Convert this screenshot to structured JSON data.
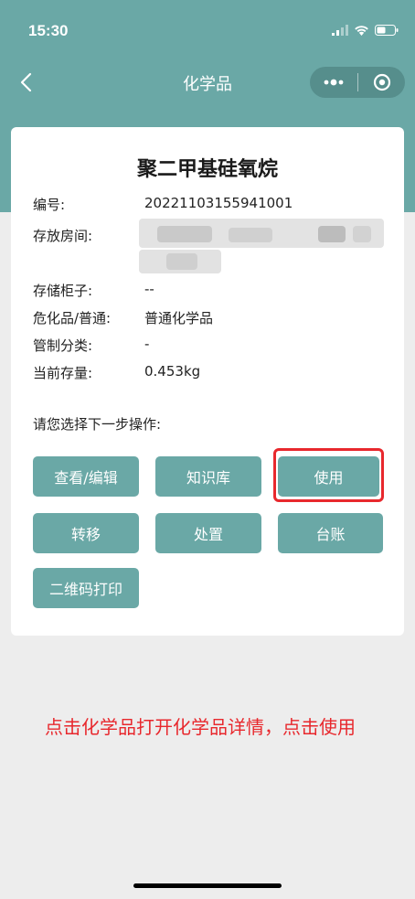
{
  "status_bar": {
    "time": "15:30"
  },
  "nav": {
    "title": "化学品"
  },
  "card": {
    "title": "聚二甲基硅氧烷",
    "fields": [
      {
        "label": "编号:",
        "value": "20221103155941001"
      },
      {
        "label": "存放房间:",
        "value": ""
      },
      {
        "label": "存储柜子:",
        "value": "--"
      },
      {
        "label": "危化品/普通:",
        "value": "普通化学品"
      },
      {
        "label": "管制分类:",
        "value": "-"
      },
      {
        "label": "当前存量:",
        "value": "0.453kg"
      }
    ],
    "prompt": "请您选择下一步操作:",
    "buttons": {
      "view_edit": "查看/编辑",
      "knowledge": "知识库",
      "use": "使用",
      "transfer": "转移",
      "dispose": "处置",
      "ledger": "台账",
      "qr_print": "二维码打印"
    }
  },
  "annotation": "点击化学品打开化学品详情，点击使用",
  "colors": {
    "header": "#6aa8a6",
    "button": "#6aa8a6",
    "highlight": "#e8282d"
  }
}
